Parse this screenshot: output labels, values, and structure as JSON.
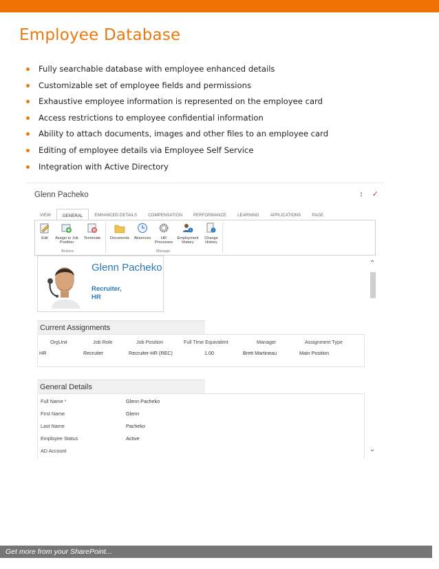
{
  "page": {
    "title": "Employee Database",
    "accent_color": "#ee7203",
    "bullets": [
      "Fully searchable database with employee enhanced details",
      "Customizable set of employee fields and permissions",
      "Exhaustive employee information is represented on the employee card",
      "Access restrictions to employee confidential information",
      "Ability to attach documents, images and other files to an employee card",
      "Editing of employee details via Employee Self Service",
      "Integration with Active Directory"
    ],
    "footer": "Get more from your SharePoint..."
  },
  "dialog": {
    "title": "Glenn Pacheko",
    "tabs": [
      "VIEW",
      "GENERAL",
      "ENHANCED DETAILS",
      "COMPENSATION",
      "PERFORMANCE",
      "LEARNING",
      "APPLICATIONS",
      "PAGE"
    ],
    "active_tab": "GENERAL",
    "ribbon": {
      "actions_label": "Actions",
      "manage_label": "Manage",
      "edit": "Edit",
      "assign": "Assign to Job Position",
      "terminate": "Terminate",
      "documents": "Documents",
      "absences": "Absences",
      "hr_processes": "HR Processes",
      "employment_history": "Employment History",
      "change_history": "Change History"
    },
    "card": {
      "name": "Glenn Pacheko",
      "role": "Recruiter,",
      "dept": "HR"
    },
    "assignments": {
      "title": "Current Assignments",
      "headers": [
        "OrgUnit",
        "Job Role",
        "Job Position",
        "Full Time Equivalent",
        "Manager",
        "Assignment Type"
      ],
      "row": [
        "HR",
        "Recruiter",
        "Recruiter-HR (REC)",
        "1.00",
        "Brett Martineau",
        "Main Position"
      ]
    },
    "general": {
      "title": "General Details",
      "fields": [
        {
          "label": "Full Name",
          "value": "Glenn Pacheko",
          "required": "*"
        },
        {
          "label": "First Name",
          "value": "Glenn"
        },
        {
          "label": "Last Name",
          "value": "Pacheko"
        },
        {
          "label": "Employee Status",
          "value": "Active"
        },
        {
          "label": "AD Account",
          "value": ""
        }
      ]
    }
  }
}
